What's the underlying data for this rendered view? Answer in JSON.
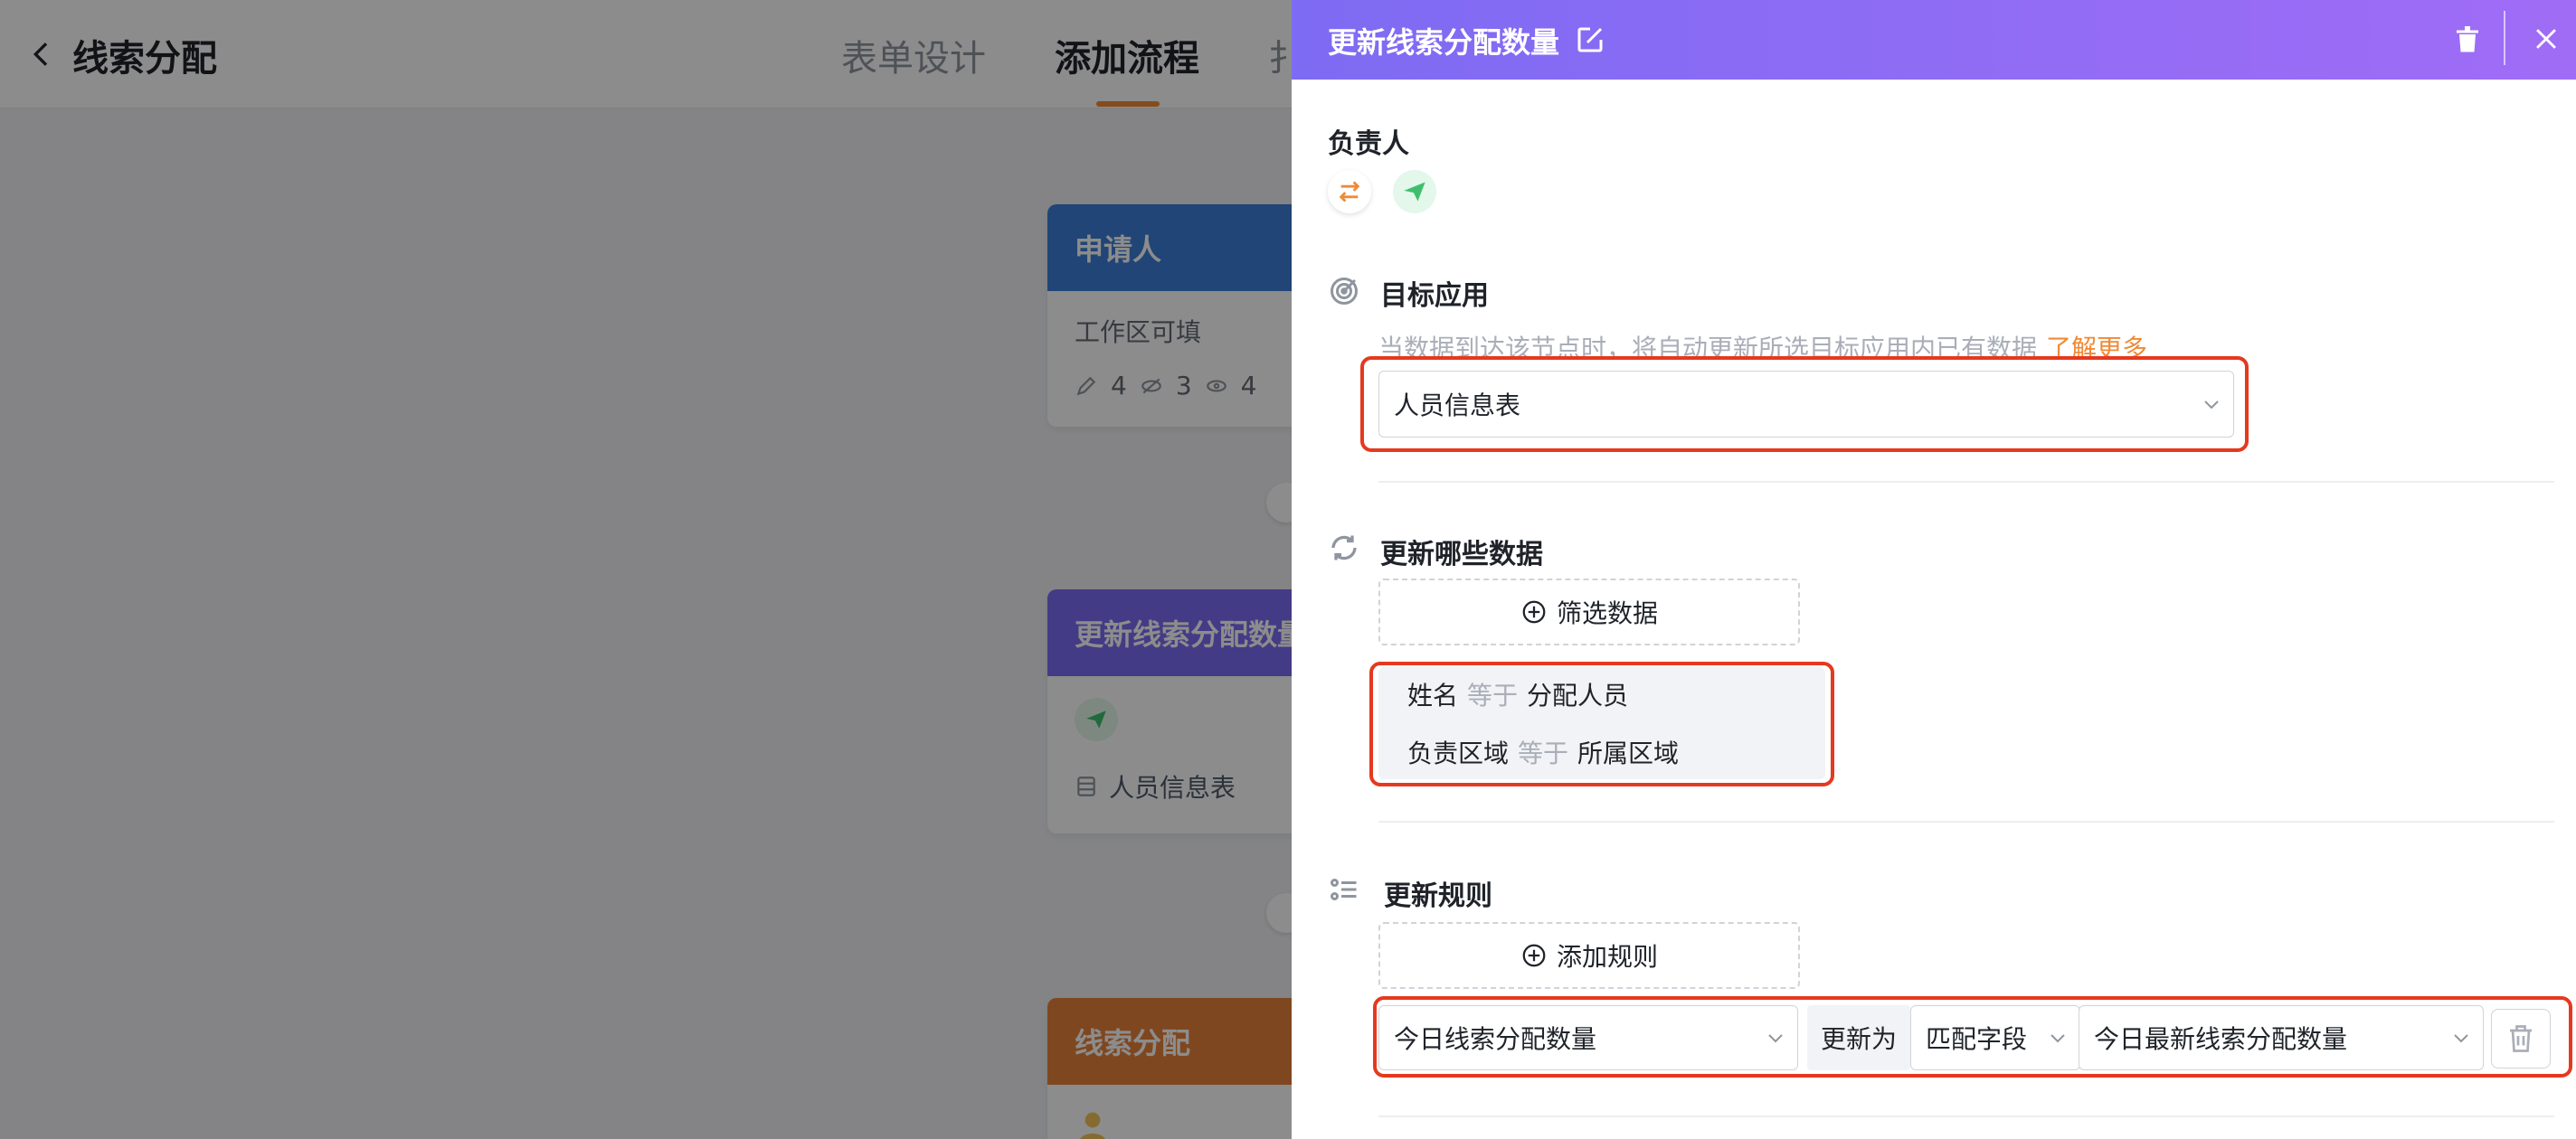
{
  "header": {
    "title": "线索分配",
    "tabs": [
      {
        "label": "表单设计"
      },
      {
        "label": "添加流程"
      },
      {
        "label": "扌"
      }
    ]
  },
  "nodes": {
    "applicant": {
      "title": "申请人",
      "subtitle": "工作区可填",
      "counts": [
        "4",
        "3",
        "4"
      ],
      "color": "#3d7ed8"
    },
    "update": {
      "title": "更新线索分配数量",
      "table": "人员信息表",
      "color": "#7b6cf2"
    },
    "assign": {
      "title": "线索分配",
      "color": "#e8813a"
    }
  },
  "drawer": {
    "title": "更新线索分配数量",
    "owner": {
      "label": "负责人"
    },
    "target_app": {
      "title": "目标应用",
      "description": "当数据到达该节点时，将自动更新所选目标应用内已有数据",
      "learn_more": "了解更多",
      "selected": "人员信息表"
    },
    "update_data": {
      "title": "更新哪些数据",
      "filter_button": "筛选数据",
      "conditions": [
        {
          "field": "姓名",
          "op": "等于",
          "value": "分配人员"
        },
        {
          "field": "负责区域",
          "op": "等于",
          "value": "所属区域"
        }
      ]
    },
    "update_rules": {
      "title": "更新规则",
      "add_button": "添加规则",
      "rule": {
        "target_field": "今日线索分配数量",
        "update_to": "更新为",
        "mode": "匹配字段",
        "source_field": "今日最新线索分配数量"
      }
    }
  },
  "colors": {
    "accent": "#f08a35",
    "highlight": "#e5391f",
    "drawer_header_start": "#7e6bf3",
    "drawer_header_end": "#a06cf6"
  }
}
